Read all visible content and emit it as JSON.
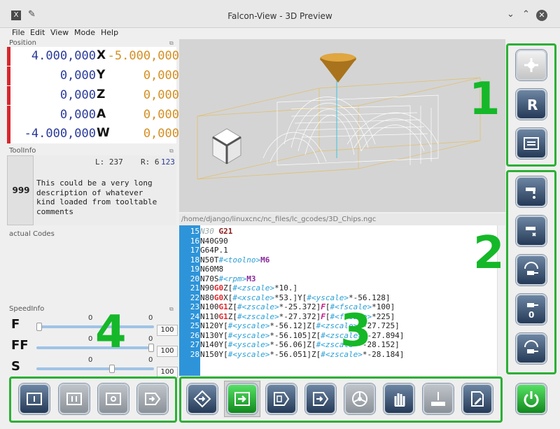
{
  "window": {
    "title": "Falcon-View - 3D Preview",
    "app_icon": "X"
  },
  "menu": [
    "File",
    "Edit",
    "View",
    "Mode",
    "Help"
  ],
  "position": {
    "title": "Position",
    "rows": [
      {
        "rel": "4.000,000",
        "axis": "X",
        "dtg": "-5.000,000"
      },
      {
        "rel": "0,000",
        "axis": "Y",
        "dtg": "0,000"
      },
      {
        "rel": "0,000",
        "axis": "Z",
        "dtg": "0,000"
      },
      {
        "rel": "0,000",
        "axis": "A",
        "dtg": "0,000"
      },
      {
        "rel": "-4.000,000",
        "axis": "W",
        "dtg": "0,000"
      }
    ]
  },
  "toolinfo": {
    "title": "ToolInfo",
    "tool_number": "999",
    "length": "L: 237",
    "radius": "R: 6",
    "extra": "123",
    "description": "This could be a very long\ndescription of whatever\nkind loaded from tooltable\ncomments"
  },
  "actual_codes": {
    "title": "actual Codes"
  },
  "speedinfo": {
    "title": "SpeedInfo",
    "rows": [
      {
        "label": "F",
        "current": "0",
        "set": "0",
        "max": "100",
        "level": 0.0
      },
      {
        "label": "FF",
        "current": "0",
        "set": "0",
        "max": "100",
        "level": 1.0
      },
      {
        "label": "S",
        "current": "0",
        "set": "0",
        "max": "100",
        "level": 0.65
      }
    ]
  },
  "gcode": {
    "path": "/home/django/linuxcnc/nc_files/lc_gcodes/3D_Chips.ngc",
    "lines": [
      {
        "n": "15",
        "segs": [
          [
            "N30 ",
            "cmt"
          ],
          [
            "G21",
            "g"
          ]
        ]
      },
      {
        "n": "16",
        "segs": [
          [
            "N40G90",
            ""
          ]
        ]
      },
      {
        "n": "17",
        "segs": [
          [
            "G64P.1",
            ""
          ]
        ]
      },
      {
        "n": "18",
        "segs": [
          [
            "N50T",
            ""
          ],
          [
            "#<toolno>",
            "var"
          ],
          [
            "M6",
            "m"
          ]
        ]
      },
      {
        "n": "19",
        "segs": [
          [
            "N60M8",
            ""
          ]
        ]
      },
      {
        "n": "20",
        "segs": [
          [
            "N70S",
            ""
          ],
          [
            "#<rpm>",
            "var"
          ],
          [
            "M3",
            "m"
          ]
        ]
      },
      {
        "n": "21",
        "segs": [
          [
            "N90",
            ""
          ],
          [
            "G0",
            "gr"
          ],
          [
            "Z[",
            ""
          ],
          [
            "#<zscale>",
            "var"
          ],
          [
            "*10.]",
            ""
          ]
        ]
      },
      {
        "n": "22",
        "segs": [
          [
            "N80",
            ""
          ],
          [
            "G0",
            "gr"
          ],
          [
            "X[",
            ""
          ],
          [
            "#<xscale>",
            "var"
          ],
          [
            "*53.]Y[",
            ""
          ],
          [
            "#<yscale>",
            "var"
          ],
          [
            "*-56.128]",
            ""
          ]
        ]
      },
      {
        "n": "23",
        "segs": [
          [
            "N100",
            ""
          ],
          [
            "G1",
            "gr"
          ],
          [
            "Z[",
            ""
          ],
          [
            "#<zscale>",
            "var"
          ],
          [
            "*-25.372]",
            ""
          ],
          [
            "F",
            "f"
          ],
          [
            "[",
            ""
          ],
          [
            "#<fscale>",
            "var"
          ],
          [
            "*100]",
            ""
          ]
        ]
      },
      {
        "n": "24",
        "segs": [
          [
            "N110",
            ""
          ],
          [
            "G1",
            "gr"
          ],
          [
            "Z[",
            ""
          ],
          [
            "#<zscale>",
            "var"
          ],
          [
            "*-27.372]",
            ""
          ],
          [
            "F",
            "f"
          ],
          [
            "[",
            ""
          ],
          [
            "#<fscale>",
            "var"
          ],
          [
            "*225]",
            ""
          ]
        ]
      },
      {
        "n": "25",
        "segs": [
          [
            "N120Y[",
            ""
          ],
          [
            "#<yscale>",
            "var"
          ],
          [
            "*-56.12]Z[",
            ""
          ],
          [
            "#<zscale>",
            "var"
          ],
          [
            "*-27.725]",
            ""
          ]
        ]
      },
      {
        "n": "26",
        "segs": [
          [
            "N130Y[",
            ""
          ],
          [
            "#<yscale>",
            "var"
          ],
          [
            "*-56.105]Z[",
            ""
          ],
          [
            "#<zscale>",
            "var"
          ],
          [
            "*-27.894]",
            ""
          ]
        ]
      },
      {
        "n": "27",
        "segs": [
          [
            "N140Y[",
            ""
          ],
          [
            "#<yscale>",
            "var"
          ],
          [
            "*-56.06]Z[",
            ""
          ],
          [
            "#<zscale>",
            "var"
          ],
          [
            "*-28.152]",
            ""
          ]
        ]
      },
      {
        "n": "28",
        "segs": [
          [
            "N150Y[",
            ""
          ],
          [
            "#<yscale>",
            "var"
          ],
          [
            "*-56.051]Z[",
            ""
          ],
          [
            "#<zscale>",
            "var"
          ],
          [
            "*-28.184]",
            ""
          ]
        ]
      }
    ]
  },
  "annotations": [
    "1",
    "2",
    "3",
    "4"
  ],
  "colors": {
    "accent_green": "#2cb035",
    "line_col": "#2e94d9",
    "dtg": "#d38f23",
    "rel": "#2a3a99"
  },
  "icons": {
    "group1": [
      "view-zoom-icon",
      "reset-r-icon",
      "file-open-icon"
    ],
    "group2": [
      "coolant-flood-icon",
      "coolant-mist-icon",
      "spindle-ccw-icon",
      "spindle-stop-icon",
      "spindle-cw-icon"
    ],
    "group3": [
      "home-icon",
      "run-icon",
      "step-icon",
      "run-from-line-icon",
      "wheel-icon",
      "manual-icon",
      "touchoff-icon",
      "edit-icon"
    ],
    "group4": [
      "stop-icon",
      "pause-icon",
      "estop-icon",
      "resume-icon"
    ],
    "power": "power-icon"
  }
}
